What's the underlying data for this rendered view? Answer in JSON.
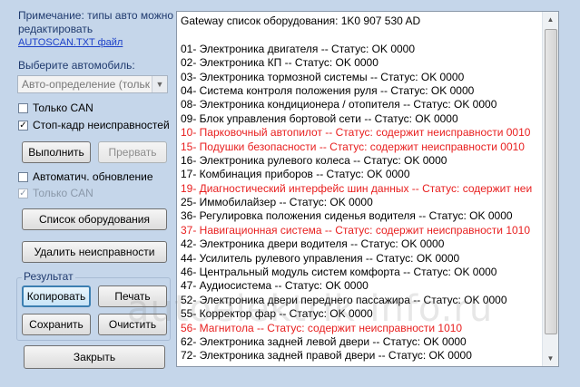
{
  "left": {
    "note": "Примечание: типы авто можно редактировать",
    "note_link": "AUTOSCAN.TXT файл",
    "select_car_label": "Выберите автомобиль:",
    "car_select_value": "Авто-определение (тольк",
    "only_can_1": "Только CAN",
    "freeze_frame": "Стоп-кадр неисправностей",
    "run_btn": "Выполнить",
    "stop_btn": "Прервать",
    "auto_update": "Автоматич. обновление",
    "only_can_2": "Только CAN",
    "equipment_list_btn": "Список оборудования",
    "clear_faults_btn": "Удалить неисправности",
    "result_group": "Результат",
    "copy_btn": "Копировать",
    "print_btn": "Печать",
    "save_btn": "Сохранить",
    "clear_btn": "Очистить",
    "close_btn": "Закрыть"
  },
  "checks": {
    "only_can_1": false,
    "freeze_frame": true,
    "auto_update": false,
    "only_can_2": true
  },
  "output": {
    "lines": [
      {
        "text": "Gateway список оборудования:  1K0 907 530 AD",
        "error": false
      },
      {
        "text": "",
        "error": false
      },
      {
        "text": "01- Электроника двигателя -- Статус: OK 0000",
        "error": false
      },
      {
        "text": "02- Электроника КП -- Статус: OK 0000",
        "error": false
      },
      {
        "text": "03- Электроника тормозной системы -- Статус: OK 0000",
        "error": false
      },
      {
        "text": "04- Система контроля положения руля -- Статус: OK 0000",
        "error": false
      },
      {
        "text": "08- Электроника кондиционера / отопителя -- Статус: OK 0000",
        "error": false
      },
      {
        "text": "09- Блок управления бортовой сети -- Статус: OK 0000",
        "error": false
      },
      {
        "text": "10- Парковочный автопилот -- Статус: содержит неисправности 0010",
        "error": true
      },
      {
        "text": "15- Подушки безопасности -- Статус: содержит неисправности 0010",
        "error": true
      },
      {
        "text": "16- Электроника рулевого колеса -- Статус: OK 0000",
        "error": false
      },
      {
        "text": "17- Комбинация приборов -- Статус: OK 0000",
        "error": false
      },
      {
        "text": "19- Диагностический интерфейс шин данных -- Статус: содержит неи",
        "error": true
      },
      {
        "text": "25- Иммобилайзер -- Статус: OK 0000",
        "error": false
      },
      {
        "text": "36- Регулировка положения сиденья водителя -- Статус: OK 0000",
        "error": false
      },
      {
        "text": "37- Навигационная система -- Статус: содержит неисправности 1010",
        "error": true
      },
      {
        "text": "42- Электроника двери водителя -- Статус: OK 0000",
        "error": false
      },
      {
        "text": "44- Усилитель рулевого управления -- Статус: OK 0000",
        "error": false
      },
      {
        "text": "46- Центральный модуль систем комфорта -- Статус: OK 0000",
        "error": false
      },
      {
        "text": "47- Аудиосистема -- Статус: OK 0000",
        "error": false
      },
      {
        "text": "52- Электроника двери переднего пассажира -- Статус: OK 0000",
        "error": false
      },
      {
        "text": "55- Корректор фар -- Статус: OK 0000",
        "error": false
      },
      {
        "text": "56- Магнитола -- Статус: содержит неисправности 1010",
        "error": true
      },
      {
        "text": "62- Электроника задней левой двери -- Статус: OK 0000",
        "error": false
      },
      {
        "text": "72- Электроника задней правой двери -- Статус: OK 0000",
        "error": false
      }
    ]
  },
  "colors": {
    "background": "#c5d6ea",
    "error_text": "#e81f1f",
    "label_text": "#1f3a6e",
    "link": "#1b3fc8"
  },
  "watermark": "autoelektrik-info.ru"
}
